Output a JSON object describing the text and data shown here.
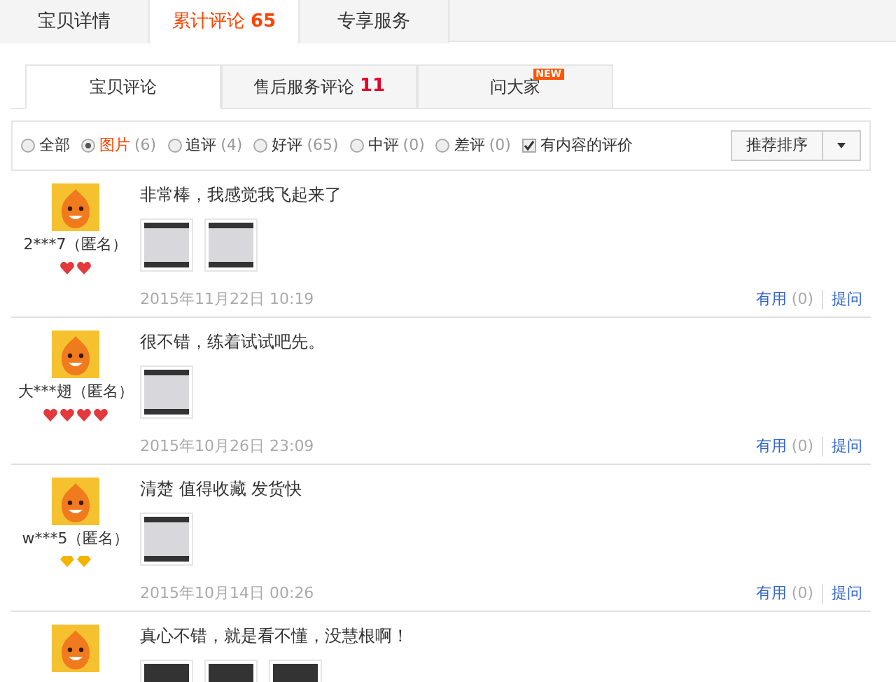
{
  "main_tabs": [
    {
      "label": "宝贝详情",
      "selected": false
    },
    {
      "label": "累计评论",
      "count": "65",
      "selected": true
    },
    {
      "label": "专享服务",
      "selected": false
    }
  ],
  "sub_tabs": [
    {
      "label": "宝贝评论",
      "selected": true
    },
    {
      "label": "售后服务评论",
      "count": "11",
      "selected": false
    },
    {
      "label": "问大家",
      "badge": "NEW",
      "selected": false
    }
  ],
  "filters": [
    {
      "label": "全部",
      "selected": false
    },
    {
      "label": "图片",
      "count": "(6)",
      "selected": true
    },
    {
      "label": "追评",
      "count": "(4)",
      "selected": false
    },
    {
      "label": "好评",
      "count": "(65)",
      "selected": false
    },
    {
      "label": "中评",
      "count": "(0)",
      "selected": false
    },
    {
      "label": "差评",
      "count": "(0)",
      "selected": false
    }
  ],
  "content_filter": {
    "label": "有内容的评价",
    "checked": true
  },
  "sort": {
    "label": "推荐排序"
  },
  "reviews": [
    {
      "user": "2***7（匿名）",
      "rank": [
        {
          "kind": "heart"
        },
        {
          "kind": "heart"
        }
      ],
      "text": "非常棒，我感觉我飞起来了",
      "photos": [
        {
          "kind": "framed"
        },
        {
          "kind": "framed"
        }
      ],
      "date": "2015年11月22日 10:19",
      "useful": "有用",
      "useful_count": "(0)",
      "ask": "提问"
    },
    {
      "user": "大***翅（匿名）",
      "rank": [
        {
          "kind": "heart"
        },
        {
          "kind": "heart"
        },
        {
          "kind": "heart"
        },
        {
          "kind": "heart"
        }
      ],
      "text": "很不错，练着试试吧先。",
      "photos": [
        {
          "kind": "framed"
        }
      ],
      "date": "2015年10月26日 23:09",
      "useful": "有用",
      "useful_count": "(0)",
      "ask": "提问"
    },
    {
      "user": "w***5（匿名）",
      "rank": [
        {
          "kind": "diamond"
        },
        {
          "kind": "diamond"
        }
      ],
      "text": "清楚 值得收藏 发货快",
      "photos": [
        {
          "kind": "framed"
        }
      ],
      "date": "2015年10月14日 00:26",
      "useful": "有用",
      "useful_count": "(0)",
      "ask": "提问"
    },
    {
      "text": "真心不错，就是看不懂，没慧根啊！",
      "photos": [
        {
          "kind": "dark"
        },
        {
          "kind": "dark"
        },
        {
          "kind": "dark"
        }
      ]
    }
  ]
}
